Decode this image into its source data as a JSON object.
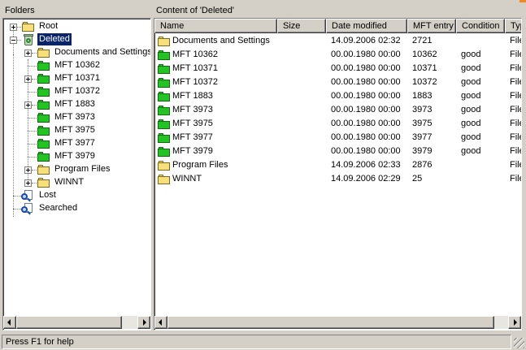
{
  "colors": {
    "selection": "#0a246a",
    "folder_yellow": "#f7e07a",
    "folder_green": "#22c322",
    "face": "#d4d0c8"
  },
  "left_pane": {
    "caption": "Folders",
    "tree": {
      "root": "Root",
      "deleted": "Deleted",
      "deleted_children": [
        {
          "label": "Documents and Settings",
          "icon": "folder-yellow-icon",
          "expandable": true
        },
        {
          "label": "MFT 10362",
          "icon": "folder-green-icon",
          "expandable": false
        },
        {
          "label": "MFT 10371",
          "icon": "folder-green-icon",
          "expandable": true
        },
        {
          "label": "MFT 10372",
          "icon": "folder-green-icon",
          "expandable": false
        },
        {
          "label": "MFT 1883",
          "icon": "folder-green-icon",
          "expandable": true
        },
        {
          "label": "MFT 3973",
          "icon": "folder-green-icon",
          "expandable": false
        },
        {
          "label": "MFT 3975",
          "icon": "folder-green-icon",
          "expandable": false
        },
        {
          "label": "MFT 3977",
          "icon": "folder-green-icon",
          "expandable": false
        },
        {
          "label": "MFT 3979",
          "icon": "folder-green-icon",
          "expandable": false
        },
        {
          "label": "Program Files",
          "icon": "folder-yellow-icon",
          "expandable": true
        },
        {
          "label": "WINNT",
          "icon": "folder-yellow-icon",
          "expandable": true
        }
      ],
      "lost": "Lost",
      "searched": "Searched"
    }
  },
  "right_pane": {
    "caption": "Content of 'Deleted'",
    "columns": [
      "Name",
      "Size",
      "Date modified",
      "MFT entry",
      "Condition",
      "Type"
    ],
    "rows": [
      {
        "name": "Documents and Settings",
        "size": "",
        "date": "14.09.2006 02:32",
        "mft": "2721",
        "condition": "",
        "type": "File",
        "icon": "yellow"
      },
      {
        "name": "MFT 10362",
        "size": "",
        "date": "00.00.1980 00:00",
        "mft": "10362",
        "condition": "good",
        "type": "File",
        "icon": "green"
      },
      {
        "name": "MFT 10371",
        "size": "",
        "date": "00.00.1980 00:00",
        "mft": "10371",
        "condition": "good",
        "type": "File",
        "icon": "green"
      },
      {
        "name": "MFT 10372",
        "size": "",
        "date": "00.00.1980 00:00",
        "mft": "10372",
        "condition": "good",
        "type": "File",
        "icon": "green"
      },
      {
        "name": "MFT 1883",
        "size": "",
        "date": "00.00.1980 00:00",
        "mft": "1883",
        "condition": "good",
        "type": "File",
        "icon": "green"
      },
      {
        "name": "MFT 3973",
        "size": "",
        "date": "00.00.1980 00:00",
        "mft": "3973",
        "condition": "good",
        "type": "File",
        "icon": "green"
      },
      {
        "name": "MFT 3975",
        "size": "",
        "date": "00.00.1980 00:00",
        "mft": "3975",
        "condition": "good",
        "type": "File",
        "icon": "green"
      },
      {
        "name": "MFT 3977",
        "size": "",
        "date": "00.00.1980 00:00",
        "mft": "3977",
        "condition": "good",
        "type": "File",
        "icon": "green"
      },
      {
        "name": "MFT 3979",
        "size": "",
        "date": "00.00.1980 00:00",
        "mft": "3979",
        "condition": "good",
        "type": "File",
        "icon": "green"
      },
      {
        "name": "Program Files",
        "size": "",
        "date": "14.09.2006 02:33",
        "mft": "2876",
        "condition": "",
        "type": "File",
        "icon": "yellow"
      },
      {
        "name": "WINNT",
        "size": "",
        "date": "14.09.2006 02:29",
        "mft": "25",
        "condition": "",
        "type": "File",
        "icon": "yellow"
      }
    ]
  },
  "status": {
    "text": "Press F1 for help"
  }
}
